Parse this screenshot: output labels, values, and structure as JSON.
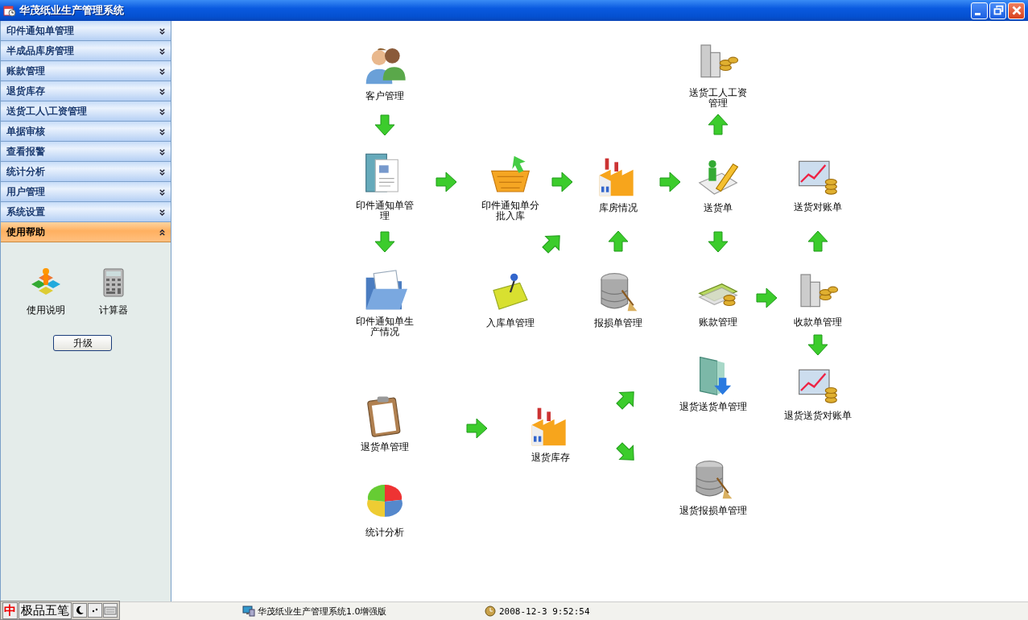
{
  "window": {
    "title": "华茂纸业生产管理系统"
  },
  "sidebar": {
    "items": [
      {
        "label": "印件通知单管理",
        "expanded": false
      },
      {
        "label": "半成品库房管理",
        "expanded": false
      },
      {
        "label": "账款管理",
        "expanded": false
      },
      {
        "label": "退货库存",
        "expanded": false
      },
      {
        "label": "送货工人\\工资管理",
        "expanded": false
      },
      {
        "label": "单据审核",
        "expanded": false
      },
      {
        "label": "查看报警",
        "expanded": false
      },
      {
        "label": "统计分析",
        "expanded": false
      },
      {
        "label": "用户管理",
        "expanded": false
      },
      {
        "label": "系统设置",
        "expanded": false
      },
      {
        "label": "使用帮助",
        "expanded": true
      }
    ],
    "tools": [
      {
        "label": "使用说明"
      },
      {
        "label": "计算器"
      }
    ],
    "button": "升级"
  },
  "flow": {
    "nodes": [
      {
        "label": "客户管理"
      },
      {
        "label": "印件通知单管理"
      },
      {
        "label": "印件通知单生产情况"
      },
      {
        "label": "印件通知单分批入库"
      },
      {
        "label": "入库单管理"
      },
      {
        "label": "库房情况"
      },
      {
        "label": "报损单管理"
      },
      {
        "label": "送货工人工资管理"
      },
      {
        "label": "送货单"
      },
      {
        "label": "账款管理"
      },
      {
        "label": "送货对账单"
      },
      {
        "label": "收款单管理"
      },
      {
        "label": "退货送货对账单"
      },
      {
        "label": "退货送货单管理"
      },
      {
        "label": "退货单管理"
      },
      {
        "label": "退货库存"
      },
      {
        "label": "退货报损单管理"
      },
      {
        "label": "统计分析"
      }
    ],
    "arrows": [
      {
        "kind": "down"
      },
      {
        "kind": "right"
      },
      {
        "kind": "right"
      },
      {
        "kind": "right"
      },
      {
        "kind": "up"
      },
      {
        "kind": "down"
      },
      {
        "kind": "upright"
      },
      {
        "kind": "up"
      },
      {
        "kind": "down"
      },
      {
        "kind": "up"
      },
      {
        "kind": "right"
      },
      {
        "kind": "down"
      },
      {
        "kind": "right"
      },
      {
        "kind": "upright"
      },
      {
        "kind": "downright"
      }
    ]
  },
  "status_bar": {
    "ime": {
      "logo": "中",
      "name": "极品五笔"
    },
    "app": "华茂纸业生产管理系统1.0增强版",
    "time": "2008-12-3 9:52:54"
  }
}
